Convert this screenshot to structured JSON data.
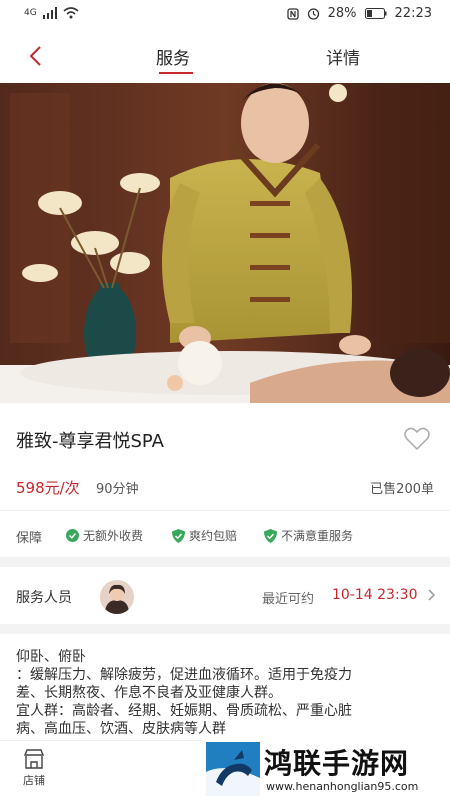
{
  "status_bar": {
    "network": "4G",
    "battery": "28%",
    "time": "22:23"
  },
  "nav": {
    "tabs": [
      {
        "label": "服务",
        "active": true
      },
      {
        "label": "详情",
        "active": false
      }
    ]
  },
  "product": {
    "title": "雅致-尊享君悦SPA",
    "price": "598元/次",
    "duration": "90分钟",
    "sold": "已售200单"
  },
  "guarantee": {
    "label": "保障",
    "items": [
      "无额外收费",
      "爽约包赔",
      "不满意重服务"
    ]
  },
  "staff": {
    "label": "服务人员",
    "available_label": "最近可约",
    "available_time": "10-14 23:30"
  },
  "description": {
    "lines": [
      "仰卧、俯卧",
      "：缓解压力、解除疲劳，促进血液循环。适用于免疫力",
      "差、长期熬夜、作息不良者及亚健康人群。",
      "宜人群：高龄者、经期、妊娠期、骨质疏松、严重心脏",
      "病、高血压、饮酒、皮肤病等人群"
    ]
  },
  "bottom_bar": {
    "store_label": "店铺"
  },
  "watermark": {
    "title": "鸿联手游网",
    "url": "www.henanhonglian95.com"
  },
  "colors": {
    "accent": "#c8282d",
    "guarantee_icon": "#3aa85c"
  }
}
